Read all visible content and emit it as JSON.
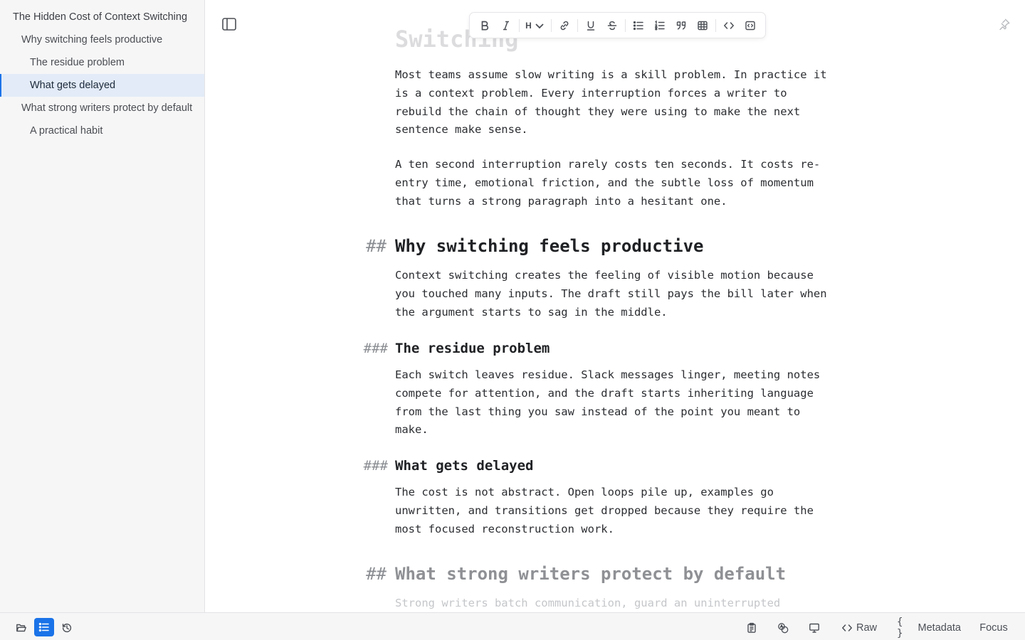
{
  "outline": {
    "items": [
      {
        "label": "The Hidden Cost of Context Switching"
      },
      {
        "label": "Why switching feels productive"
      },
      {
        "label": "The residue problem"
      },
      {
        "label": "What gets delayed"
      },
      {
        "label": "What strong writers protect by default"
      },
      {
        "label": "A practical habit"
      }
    ]
  },
  "document": {
    "top_heading_fragment": "Switching",
    "para1": "Most teams assume slow writing is a skill problem. In practice it is a context problem. Every interruption forces a writer to rebuild the chain of thought they were using to make the next sentence make sense.",
    "para2": "A ten second interruption rarely costs ten seconds. It costs re-entry time, emotional friction, and the subtle loss of momentum that turns a strong paragraph into a hesitant one.",
    "h2_marker": "##",
    "h3_marker": "###",
    "heading1": "Why switching feels productive",
    "para3": "Context switching creates the feeling of visible motion because you touched many inputs. The draft still pays the bill later when the argument starts to sag in the middle.",
    "heading2": "The residue problem",
    "para4": "Each switch leaves residue. Slack messages linger, meeting notes compete for attention, and the draft starts inheriting language from the last thing you saw instead of the point you meant to make.",
    "heading3": "What gets delayed",
    "para5": "The cost is not abstract. Open loops pile up, examples go unwritten, and transitions get dropped because they require the most focused reconstruction work.",
    "heading4": "What strong writers protect by default",
    "para6": "Strong writers batch communication, guard an uninterrupted"
  },
  "toolbar": {
    "heading_label": "H",
    "icons": [
      "bold-icon",
      "italic-icon",
      "heading-icon",
      "link-icon",
      "underline-icon",
      "strikethrough-icon",
      "bullet-list-icon",
      "numbered-list-icon",
      "quote-icon",
      "table-icon",
      "code-icon",
      "code-block-icon"
    ]
  },
  "bottombar": {
    "raw_label": "Raw",
    "metadata_label": "Metadata",
    "focus_label": "Focus"
  },
  "colors": {
    "accent": "#1a73e8",
    "active_row": "#e2ebf7",
    "sidebar_bg": "#f6f6f7"
  }
}
